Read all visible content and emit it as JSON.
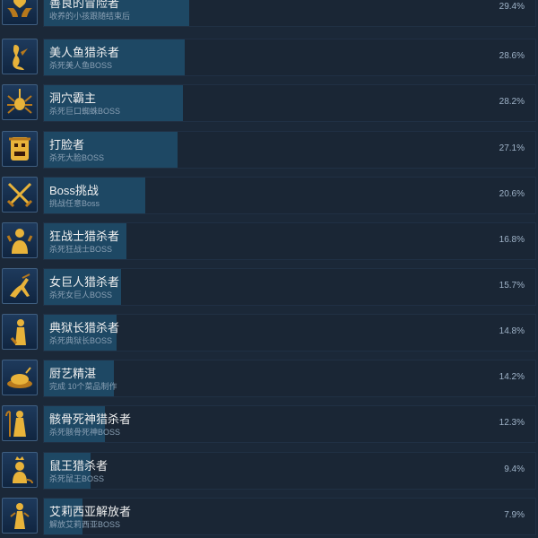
{
  "achievements": [
    {
      "name": "善良的冒险者",
      "desc": "收养的小孩跟随结束后",
      "percent": "29.4%",
      "value": 29.4,
      "icon": "heart-hands-icon"
    },
    {
      "name": "美人鱼猎杀者",
      "desc": "杀死美人鱼BOSS",
      "percent": "28.6%",
      "value": 28.6,
      "icon": "mermaid-icon"
    },
    {
      "name": "洞穴霸主",
      "desc": "杀死巨口蜘蛛BOSS",
      "percent": "28.2%",
      "value": 28.2,
      "icon": "spider-icon"
    },
    {
      "name": "打脸者",
      "desc": "杀死大脸BOSS",
      "percent": "27.1%",
      "value": 27.1,
      "icon": "mask-face-icon"
    },
    {
      "name": "Boss挑战",
      "desc": "挑战任意Boss",
      "percent": "20.6%",
      "value": 20.6,
      "icon": "crossed-swords-icon"
    },
    {
      "name": "狂战士猎杀者",
      "desc": "杀死狂战士BOSS",
      "percent": "16.8%",
      "value": 16.8,
      "icon": "berserker-icon"
    },
    {
      "name": "女巨人猎杀者",
      "desc": "杀死女巨人BOSS",
      "percent": "15.7%",
      "value": 15.7,
      "icon": "giantess-icon"
    },
    {
      "name": "典狱长猎杀者",
      "desc": "杀死典狱长BOSS",
      "percent": "14.8%",
      "value": 14.8,
      "icon": "warden-icon"
    },
    {
      "name": "厨艺精湛",
      "desc": "完成 10个菜品制作",
      "percent": "14.2%",
      "value": 14.2,
      "icon": "roast-dish-icon"
    },
    {
      "name": "骸骨死神猎杀者",
      "desc": "杀死骸骨死神BOSS",
      "percent": "12.3%",
      "value": 12.3,
      "icon": "reaper-icon"
    },
    {
      "name": "鼠王猎杀者",
      "desc": "杀死鼠王BOSS",
      "percent": "9.4%",
      "value": 9.4,
      "icon": "rat-king-icon"
    },
    {
      "name": "艾莉西亚解放者",
      "desc": "解放艾莉西亚BOSS",
      "percent": "7.9%",
      "value": 7.9,
      "icon": "alicia-icon"
    }
  ],
  "colors": {
    "bar": "#1e4864",
    "icon_gold": "#e8b33a",
    "background": "#1b2838"
  }
}
